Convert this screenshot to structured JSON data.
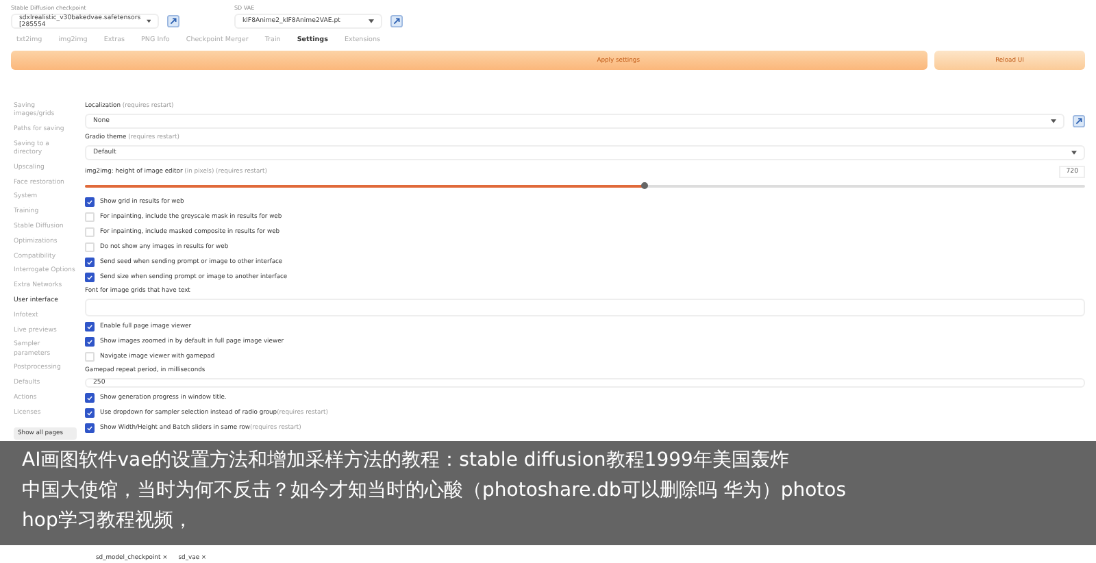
{
  "model_bar": [
    {
      "label": "Stable Diffusion checkpoint",
      "value": "sdxlrealistic_v30bakedvae.safetensors [285554"
    },
    {
      "label": "SD VAE",
      "value": "klF8Anime2_klF8Anime2VAE.pt"
    }
  ],
  "tabs": [
    {
      "label": "txt2img",
      "selected": false
    },
    {
      "label": "img2img",
      "selected": false
    },
    {
      "label": "Extras",
      "selected": false
    },
    {
      "label": "PNG Info",
      "selected": false
    },
    {
      "label": "Checkpoint Merger",
      "selected": false
    },
    {
      "label": "Train",
      "selected": false
    },
    {
      "label": "Settings",
      "selected": true
    },
    {
      "label": "Extensions",
      "selected": false
    }
  ],
  "actions": {
    "apply": "Apply settings",
    "reload": "Reload UI"
  },
  "sidebar": {
    "items": [
      {
        "label": "Saving images/grids",
        "selected": false
      },
      {
        "label": "Paths for saving",
        "selected": false
      },
      {
        "label": "Saving to a directory",
        "selected": false
      },
      {
        "label": "Upscaling",
        "selected": false
      },
      {
        "label": "Face restoration",
        "selected": false
      },
      {
        "label": "System",
        "selected": false
      },
      {
        "label": "Training",
        "selected": false
      },
      {
        "label": "Stable Diffusion",
        "selected": false
      },
      {
        "label": "Optimizations",
        "selected": false
      },
      {
        "label": "Compatibility",
        "selected": false
      },
      {
        "label": "Interrogate Options",
        "selected": false
      },
      {
        "label": "Extra Networks",
        "selected": false
      },
      {
        "label": "User interface",
        "selected": true
      },
      {
        "label": "Infotext",
        "selected": false
      },
      {
        "label": "Live previews",
        "selected": false
      },
      {
        "label": "Sampler parameters",
        "selected": false
      },
      {
        "label": "Postprocessing",
        "selected": false
      },
      {
        "label": "Defaults",
        "selected": false
      },
      {
        "label": "Actions",
        "selected": false
      },
      {
        "label": "Licenses",
        "selected": false
      }
    ],
    "show_all": "Show all pages"
  },
  "settings": [
    {
      "kind": "dropdown",
      "label": "Localization",
      "note": "(requires restart)",
      "value": "None",
      "refresh": true
    },
    {
      "kind": "dropdown",
      "label": "Gradio theme",
      "note": "(requires restart)",
      "value": "Default",
      "refresh": false
    },
    {
      "kind": "slider",
      "label": "img2img: height of image editor",
      "note": "(in pixels) (requires restart)",
      "level": 0.56,
      "value": "720"
    },
    {
      "kind": "checkbox",
      "label": "Show grid in results for web",
      "checked": true
    },
    {
      "kind": "checkbox",
      "label": "For inpainting, include the greyscale mask in results for web",
      "checked": false
    },
    {
      "kind": "checkbox",
      "label": "For inpainting, include masked composite in results for web",
      "checked": false
    },
    {
      "kind": "checkbox",
      "label": "Do not show any images in results for web",
      "checked": false
    },
    {
      "kind": "checkbox",
      "label": "Send seed when sending prompt or image to other interface",
      "checked": true
    },
    {
      "kind": "checkbox",
      "label": "Send size when sending prompt or image to another interface",
      "checked": true
    },
    {
      "kind": "textarea",
      "label": "Font for image grids that have text"
    },
    {
      "kind": "checkbox",
      "label": "Enable full page image viewer",
      "checked": true
    },
    {
      "kind": "checkbox",
      "label": "Show images zoomed in by default in full page image viewer",
      "checked": true
    },
    {
      "kind": "checkbox",
      "label": "Navigate image viewer with gamepad",
      "checked": false
    },
    {
      "kind": "number",
      "label": "Gamepad repeat period, in milliseconds",
      "value": "250"
    },
    {
      "kind": "checkbox",
      "label": "Show generation progress in window title.",
      "checked": true
    },
    {
      "kind": "checkbox",
      "label": "Use dropdown for sampler selection instead of radio group",
      "note": "(requires restart)",
      "checked": true
    },
    {
      "kind": "checkbox",
      "label": "Show Width/Height and Batch sliders in same row",
      "note": "(requires restart)",
      "checked": true
    },
    {
      "kind": "tags",
      "tags": [
        "sd_model_checkpoint ×",
        "sd_vae ×"
      ]
    }
  ],
  "caption": {
    "lines": [
      "AI画图软件vae的设置方法和增加采样方法的教程：stable diffusion教程1999年美国轰炸",
      "中国大使馆，当时为何不反击？如今才知当时的心酸（photoshare.db可以删除吗 华为）photos",
      "hop学习教程视频，"
    ]
  }
}
